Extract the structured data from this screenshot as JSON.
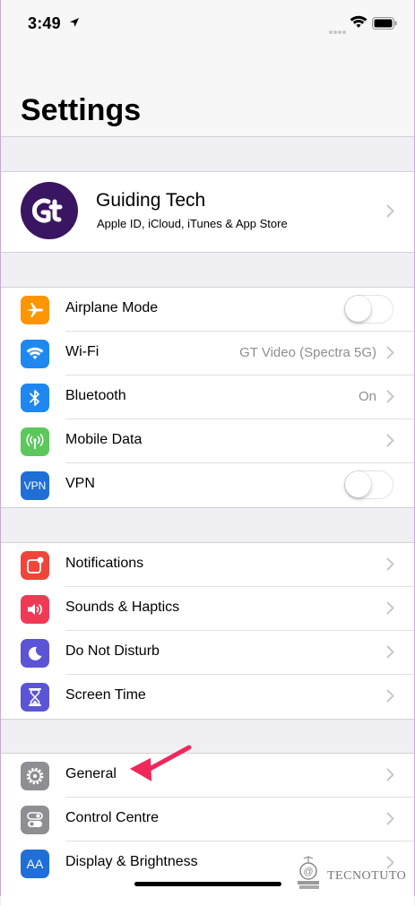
{
  "status_bar": {
    "time": "3:49"
  },
  "page": {
    "title": "Settings"
  },
  "profile": {
    "name": "Guiding Tech",
    "subtitle": "Apple ID, iCloud, iTunes & App Store",
    "avatar_text": "Gt"
  },
  "connectivity": [
    {
      "label": "Airplane Mode",
      "color": "#ff9500",
      "icon": "airplane-icon",
      "toggle": false
    },
    {
      "label": "Wi-Fi",
      "value": "GT Video (Spectra 5G)",
      "color": "#1e88f0",
      "icon": "wifi-icon"
    },
    {
      "label": "Bluetooth",
      "value": "On",
      "color": "#1e88f0",
      "icon": "bluetooth-icon"
    },
    {
      "label": "Mobile Data",
      "color": "#5ac85a",
      "icon": "antenna-icon"
    },
    {
      "label": "VPN",
      "color": "#1f6fd6",
      "icon": "vpn-icon",
      "icon_text": "VPN",
      "toggle": false
    }
  ],
  "notifications_group": [
    {
      "label": "Notifications",
      "color": "#f0453a",
      "icon": "notifications-icon"
    },
    {
      "label": "Sounds & Haptics",
      "color": "#f03a55",
      "icon": "speaker-icon"
    },
    {
      "label": "Do Not Disturb",
      "color": "#5b55d6",
      "icon": "moon-icon"
    },
    {
      "label": "Screen Time",
      "color": "#5b55d6",
      "icon": "hourglass-icon"
    }
  ],
  "general_group": [
    {
      "label": "General",
      "color": "#8e8e93",
      "icon": "gear-icon"
    },
    {
      "label": "Control Centre",
      "color": "#8e8e93",
      "icon": "switches-icon"
    },
    {
      "label": "Display & Brightness",
      "color": "#1f6fd6",
      "icon": "text-size-icon",
      "icon_text": "AA"
    }
  ],
  "watermark": {
    "text": "TECNOTUTO"
  },
  "annotation": {
    "color": "#f0285a"
  }
}
